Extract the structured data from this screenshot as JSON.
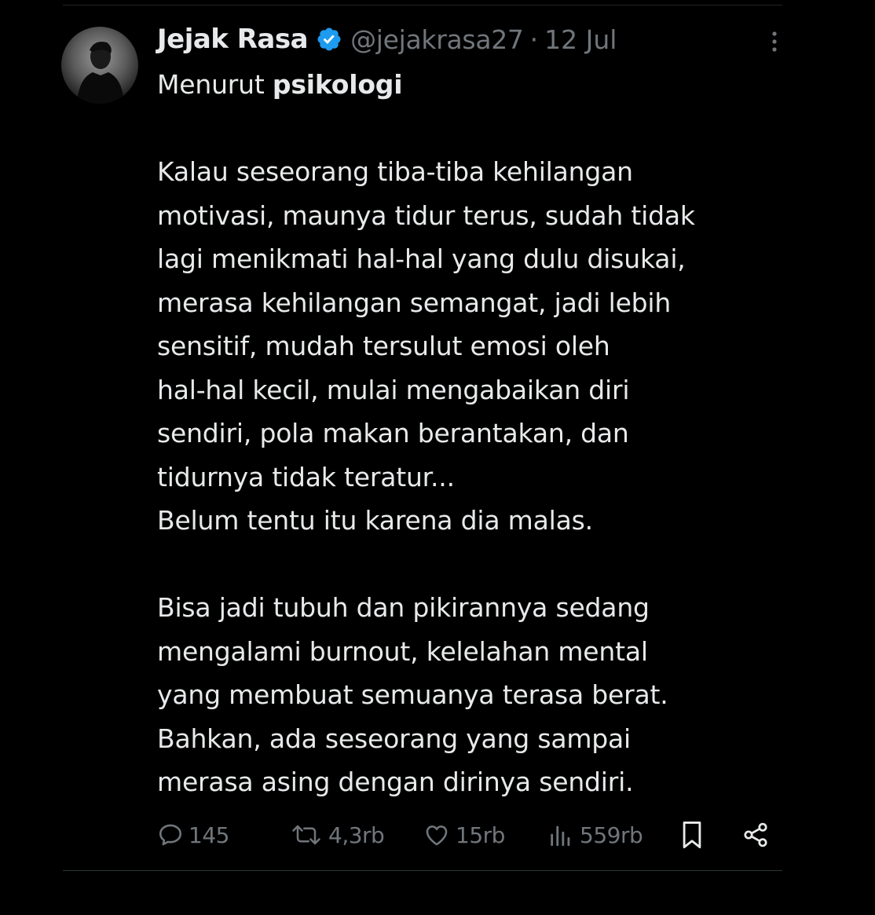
{
  "tweet": {
    "author": {
      "display_name": "Jejak Rasa",
      "handle": "@jejakrasa27",
      "verified": true
    },
    "separator": "·",
    "date": "12 Jul",
    "text_first": {
      "prefix": "Menurut ",
      "bold": "psikologi"
    },
    "lines": [
      "",
      "Kalau seseorang tiba-tiba kehilangan",
      "motivasi, maunya tidur terus, sudah tidak",
      "lagi menikmati hal-hal yang dulu disukai,",
      "merasa kehilangan semangat, jadi lebih",
      "sensitif, mudah tersulut emosi oleh",
      "hal-hal kecil, mulai mengabaikan diri",
      "sendiri, pola makan berantakan, dan",
      "tidurnya tidak teratur...",
      "Belum tentu itu karena dia malas.",
      "",
      "Bisa jadi tubuh dan pikirannya sedang",
      "mengalami burnout, kelelahan mental",
      "yang membuat semuanya terasa berat.",
      "Bahkan, ada seseorang yang sampai",
      "merasa asing dengan dirinya sendiri."
    ],
    "actions": {
      "replies": "145",
      "reposts": "4,3rb",
      "likes": "15rb",
      "views": "559rb"
    }
  },
  "icons": {
    "verified": "verified-badge-icon",
    "more": "more-options-icon",
    "reply": "reply-icon",
    "repost": "repost-icon",
    "like": "heart-icon",
    "views": "views-chart-icon",
    "bookmark": "bookmark-icon",
    "share": "share-icon"
  },
  "colors": {
    "background": "#000000",
    "text": "#e7e9ea",
    "muted": "#71767b",
    "verified": "#1d9bf0"
  }
}
